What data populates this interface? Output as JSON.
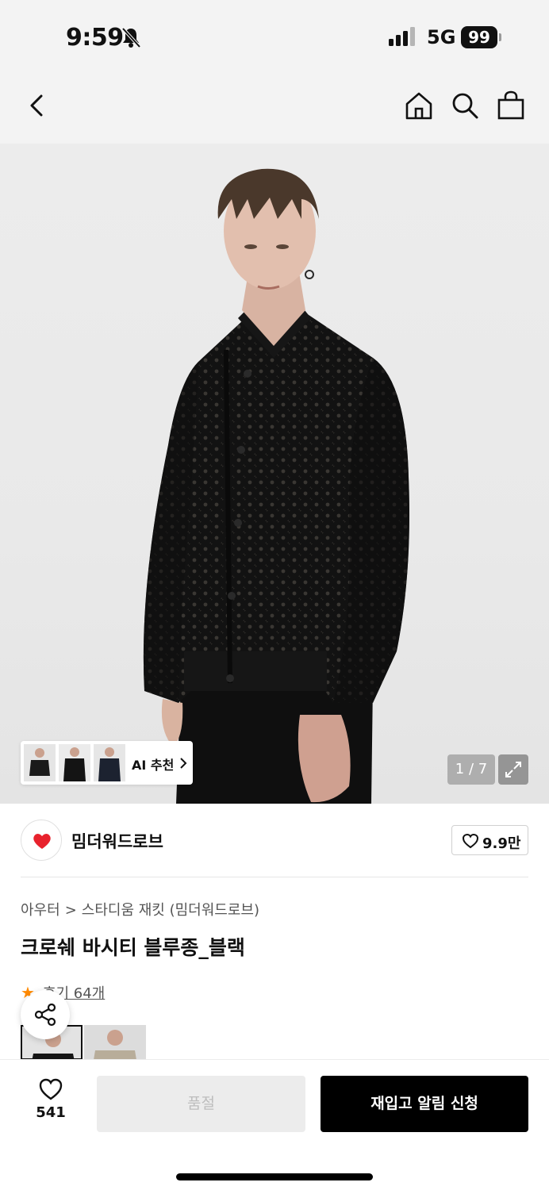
{
  "status_bar": {
    "time": "9:59",
    "network": "5G",
    "battery": "99"
  },
  "nav": {
    "icons": [
      "back-icon",
      "home-icon",
      "search-icon",
      "shopping-bag-icon"
    ]
  },
  "gallery": {
    "ai_label": "AI 추천",
    "pager": "1 / 7"
  },
  "brand": {
    "name": "밈더워드로브",
    "likes": "9.9만",
    "logo_color": "#e8222d"
  },
  "breadcrumb": {
    "category": "아우터",
    "separator": ">",
    "subcategory": "스타디움 재킷 (밈더워드로브)"
  },
  "product": {
    "title": "크로쉐 바시티 블루종_블랙",
    "rating_star": "★",
    "reviews": "후기 64개"
  },
  "bottom_bar": {
    "wish_count": "541",
    "soldout_label": "품절",
    "restock_label": "재입고 알림 신청"
  },
  "colors": {
    "accent": "#000000",
    "star": "#ff8a00"
  }
}
